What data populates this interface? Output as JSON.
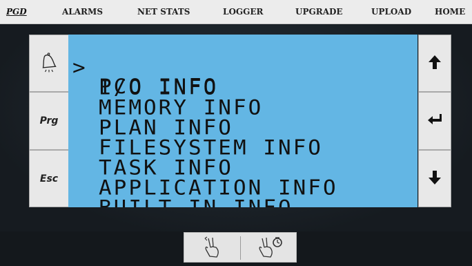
{
  "topnav": {
    "items": [
      {
        "label": "PGD",
        "active": true
      },
      {
        "label": "ALARMS"
      },
      {
        "label": "NET STATS"
      },
      {
        "label": "LOGGER"
      },
      {
        "label": "UPGRADE"
      },
      {
        "label": "UPLOAD"
      },
      {
        "label": "HOME"
      }
    ]
  },
  "left_buttons": {
    "alarm_icon": "bell-icon",
    "prg": "Prg",
    "esc": "Esc"
  },
  "right_buttons": {
    "up_icon": "arrow-up-icon",
    "enter_icon": "enter-icon",
    "down_icon": "arrow-down-icon"
  },
  "lcd": {
    "cursor": ">",
    "items": [
      "PCO INFO",
      "I/O INFO",
      "MEMORY INFO",
      "PLAN INFO",
      "FILESYSTEM INFO",
      "TASK INFO",
      "APPLICATION INFO",
      "BUILT IN INFO"
    ],
    "selected_index": 0
  },
  "gestures": {
    "left_icon": "two-finger-swipe-icon",
    "right_icon": "two-finger-hold-timer-icon"
  },
  "colors": {
    "lcd_bg": "#63b6e4",
    "button_bg": "#e8e8e8",
    "topbar_bg": "#ececec"
  }
}
